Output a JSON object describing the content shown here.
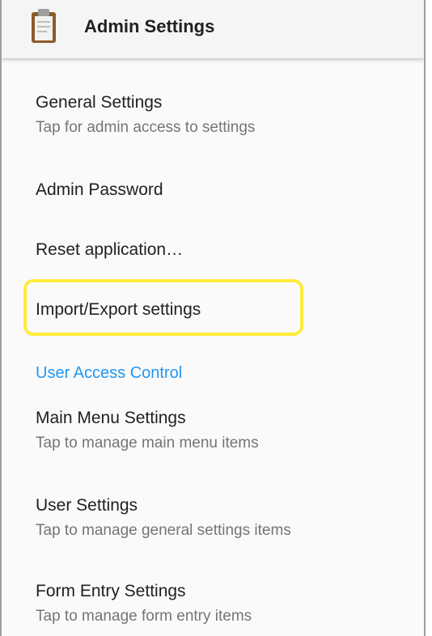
{
  "toolbar": {
    "title": "Admin Settings",
    "icon": "clipboard-icon"
  },
  "preferences": [
    {
      "title": "General Settings",
      "summary": "Tap for admin access to settings"
    },
    {
      "title": "Admin Password",
      "summary": ""
    },
    {
      "title": "Reset application…",
      "summary": ""
    },
    {
      "title": "Import/Export settings",
      "summary": ""
    }
  ],
  "user_access": {
    "category": "User Access Control",
    "items": [
      {
        "title": "Main Menu Settings",
        "summary": "Tap to manage main menu items"
      },
      {
        "title": "User Settings",
        "summary": "Tap to manage general settings items"
      },
      {
        "title": "Form Entry Settings",
        "summary": "Tap to manage form entry items"
      }
    ]
  },
  "colors": {
    "accent": "#2196f3",
    "highlight": "#ffeb3b"
  }
}
